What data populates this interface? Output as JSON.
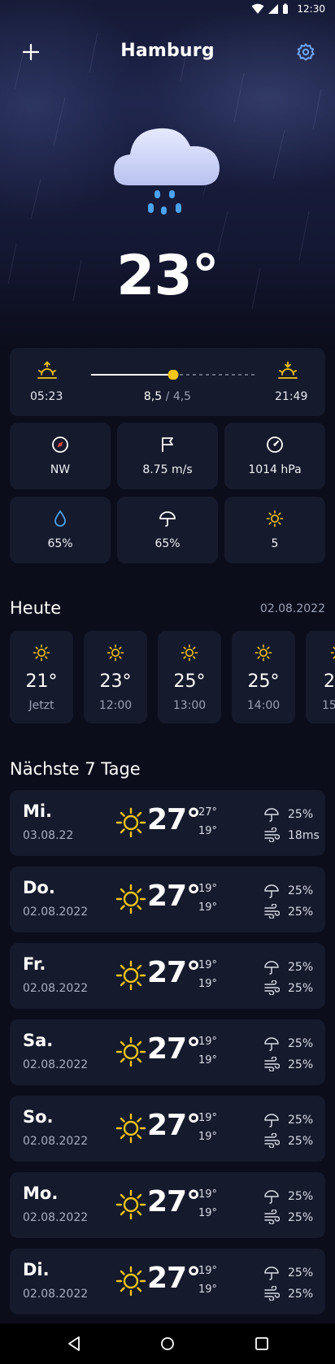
{
  "status_bar": {
    "time": "12:30",
    "icons": [
      "wifi-icon",
      "signal-icon",
      "battery-icon"
    ]
  },
  "header": {
    "city": "Hamburg",
    "add_icon": "plus-icon",
    "settings_icon": "gear-icon"
  },
  "current": {
    "temperature": "23°",
    "condition_icon": "cloud-rain-icon"
  },
  "sun": {
    "sunrise": "05:23",
    "sunset": "21:49",
    "uv_current": "8,5",
    "separator": " / ",
    "uv_other": "4,5",
    "day_progress": 0.5
  },
  "tiles": [
    {
      "icon": "compass-icon",
      "value": "NW"
    },
    {
      "icon": "flag-icon",
      "value": "8.75 m/s"
    },
    {
      "icon": "gauge-icon",
      "value": "1014 hPa"
    },
    {
      "icon": "droplet-icon",
      "value": "65%"
    },
    {
      "icon": "umbrella-icon",
      "value": "65%"
    },
    {
      "icon": "sun-icon",
      "value": "5"
    }
  ],
  "today": {
    "title": "Heute",
    "date": "02.08.2022",
    "hours": [
      {
        "temp": "21°",
        "time": "Jetzt"
      },
      {
        "temp": "23°",
        "time": "12:00"
      },
      {
        "temp": "25°",
        "time": "13:00"
      },
      {
        "temp": "25°",
        "time": "14:00"
      },
      {
        "temp": "2",
        "time": "15"
      }
    ]
  },
  "week": {
    "title": "Nächste 7 Tage",
    "days": [
      {
        "name": "Mi.",
        "date": "03.08.22",
        "temp": "27°",
        "hi": "27°",
        "lo": "19°",
        "rain": "25%",
        "wind": "18ms"
      },
      {
        "name": "Do.",
        "date": "02.08.2022",
        "temp": "27°",
        "hi": "19°",
        "lo": "19°",
        "rain": "25%",
        "wind": "25%"
      },
      {
        "name": "Fr.",
        "date": "02.08.2022",
        "temp": "27°",
        "hi": "19°",
        "lo": "19°",
        "rain": "25%",
        "wind": "25%"
      },
      {
        "name": "Sa.",
        "date": "02.08.2022",
        "temp": "27°",
        "hi": "19°",
        "lo": "19°",
        "rain": "25%",
        "wind": "25%"
      },
      {
        "name": "So.",
        "date": "02.08.2022",
        "temp": "27°",
        "hi": "19°",
        "lo": "19°",
        "rain": "25%",
        "wind": "25%"
      },
      {
        "name": "Mo.",
        "date": "02.08.2022",
        "temp": "27°",
        "hi": "19°",
        "lo": "19°",
        "rain": "25%",
        "wind": "25%"
      },
      {
        "name": "Di.",
        "date": "02.08.2022",
        "temp": "27°",
        "hi": "19°",
        "lo": "19°",
        "rain": "25%",
        "wind": "25%"
      }
    ]
  },
  "colors": {
    "accent_sun": "#f5c518",
    "accent_rain": "#4aa3f0",
    "card": "#151a2c",
    "background": "#0b0d1b"
  }
}
